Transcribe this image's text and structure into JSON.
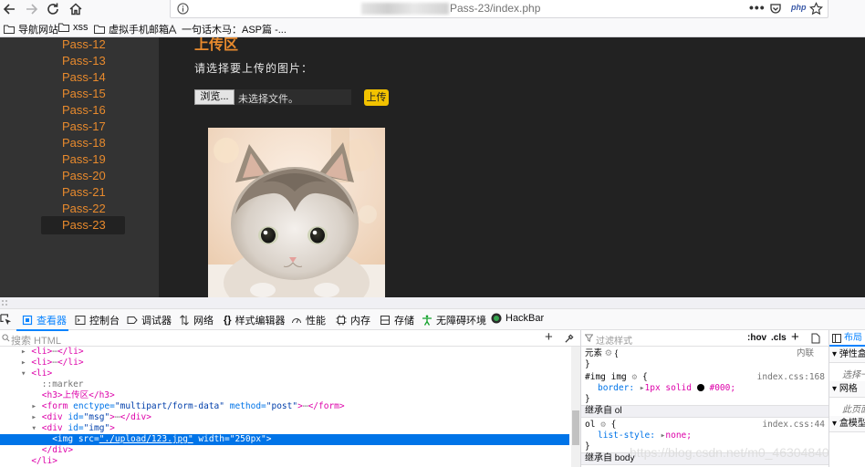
{
  "browser": {
    "url_visible": "Pass-23/index.php",
    "url_icons": [
      "more-dots-icon",
      "pocket-icon",
      "php-icon",
      "star-icon"
    ],
    "php_label": "php",
    "bookmarks": [
      {
        "label": "导航网站",
        "icon": "folder-icon"
      },
      {
        "label": "xss",
        "icon": "folder-icon"
      },
      {
        "label": "虚拟手机邮箱",
        "icon": "folder-icon"
      },
      {
        "label": "一句话木马：ASP篇 -...",
        "icon": "page-icon"
      }
    ]
  },
  "page": {
    "sidebar_items": [
      "Pass-12",
      "Pass-13",
      "Pass-14",
      "Pass-15",
      "Pass-16",
      "Pass-17",
      "Pass-18",
      "Pass-19",
      "Pass-20",
      "Pass-21",
      "Pass-22",
      "Pass-23"
    ],
    "active_item": "Pass-23",
    "heading": "上传区",
    "prompt": "请选择要上传的图片：",
    "browse_label": "浏览...",
    "no_file_label": "未选择文件。",
    "upload_label": "上传",
    "accent_color": "#e88a2d",
    "button_color": "#f2c200"
  },
  "devtools": {
    "tabs": [
      {
        "label": "查看器",
        "icon": "inspector-icon"
      },
      {
        "label": "控制台",
        "icon": "console-icon"
      },
      {
        "label": "调试器",
        "icon": "debugger-icon"
      },
      {
        "label": "网络",
        "icon": "network-icon"
      },
      {
        "label": "样式编辑器",
        "icon": "style-editor-icon"
      },
      {
        "label": "性能",
        "icon": "performance-icon"
      },
      {
        "label": "内存",
        "icon": "memory-icon"
      },
      {
        "label": "存储",
        "icon": "storage-icon"
      },
      {
        "label": "无障碍环境",
        "icon": "accessibility-icon"
      },
      {
        "label": "HackBar",
        "icon": "hackbar-icon"
      }
    ],
    "search_placeholder": "搜索 HTML",
    "filter_placeholder": "过滤样式",
    "hov_label": ":hov",
    "cls_label": ".cls",
    "markup": {
      "li_tag": "<li>",
      "li_close": "</li>",
      "ellipsis": "⋯",
      "li_open": "<li>",
      "marker": "::marker",
      "h3_line": "<h3>上传区</h3>",
      "form_open": "<form",
      "form_enctype_attr": "enctype=",
      "form_enctype_val": "\"multipart/form-data\"",
      "form_method_attr": "method=",
      "form_method_val": "\"post\"",
      "form_close": "</form>",
      "div_open": "<div",
      "id_attr": "id=",
      "msg_val": "\"msg\"",
      "img_val": "\"img\"",
      "div_close": "</div>",
      "img_tag": "<img",
      "src_attr": "src=",
      "src_val": "\"./upload/123.jpg\"",
      "width_attr": "width=",
      "width_val": "\"250px\"",
      "tag_end": ">",
      "selected_line": "<img src=\"./upload/123.jpg\" width=\"250px\">",
      "li_end_line": "</li>"
    },
    "rules": {
      "element_label": "元素",
      "inline_label": "内联",
      "brace_open": "{",
      "brace_close": "}",
      "rule1_selector": "#img img",
      "rule1_source": "index.css:168",
      "rule1_prop": "border:",
      "rule1_val_a": "1px solid",
      "rule1_val_b": "#000;",
      "inherit1": "继承自 ol",
      "rule2_selector": "ol",
      "rule2_source": "index.css:44",
      "rule2_prop": "list-style:",
      "rule2_val": "none;",
      "inherit2": "继承自 body"
    },
    "layout_panel": {
      "tab": "布局",
      "flex_label": "弹性盒",
      "flex_text": "选择一",
      "grid_label": "网格",
      "grid_text": "此页面",
      "box_label": "盒模型"
    }
  },
  "watermark": "https://blog.csdn.net/m0_46304840"
}
